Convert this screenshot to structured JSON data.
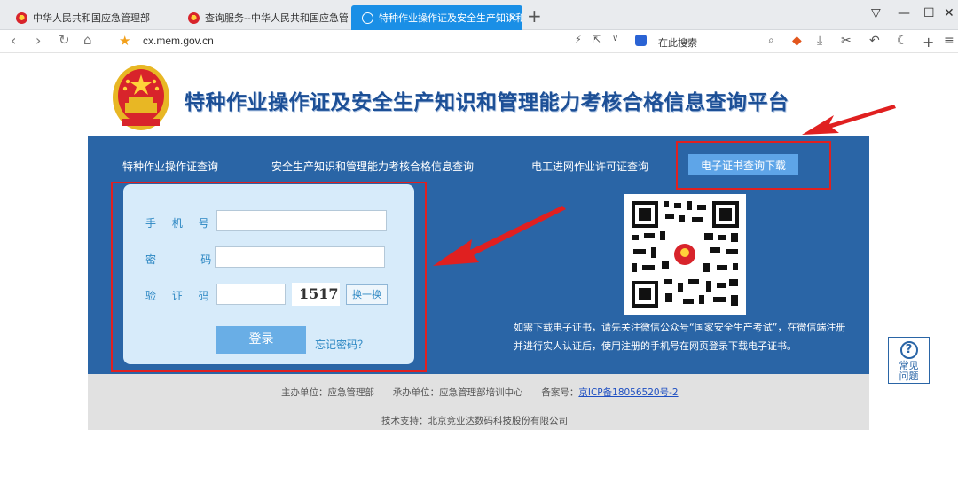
{
  "browser": {
    "tabs": [
      {
        "label": "中华人民共和国应急管理部"
      },
      {
        "label": "查询服务--中华人民共和国应急管理部"
      },
      {
        "label": "特种作业操作证及安全生产知识和管"
      }
    ],
    "url": "cx.mem.gov.cn",
    "search_placeholder": "在此搜索"
  },
  "page": {
    "title": "特种作业操作证及安全生产知识和管理能力考核合格信息查询平台",
    "nav": [
      {
        "label": "特种作业操作证查询"
      },
      {
        "label": "安全生产知识和管理能力考核合格信息查询"
      },
      {
        "label": "电工进网作业许可证查询"
      },
      {
        "label": "电子证书查询下载"
      }
    ],
    "login": {
      "phone_label": "手 机 号：",
      "password_label": "密    码：",
      "captcha_label": "验 证 码：",
      "captcha_text": "1517",
      "swap_label": "换一换",
      "login_button": "登录",
      "forgot_link": "忘记密码？"
    },
    "note": "如需下载电子证书，请先关注微信公众号“国家安全生产考试”，在微信端注册并进行实人认证后，使用注册的手机号在网页登录下载电子证书。",
    "footer": {
      "sponsor": "主办单位：应急管理部",
      "organizer": "承办单位：应急管理部培训中心",
      "icp_prefix": "备案号：",
      "icp_link": "京ICP备18056520号-2",
      "support": "技术支持：北京竞业达数码科技股份有限公司"
    },
    "help": {
      "line1": "常见",
      "line2": "问题"
    }
  },
  "colors": {
    "panel_blue": "#2a65a6",
    "tab_active": "#1a8fe6",
    "annotation_red": "#e02020"
  }
}
